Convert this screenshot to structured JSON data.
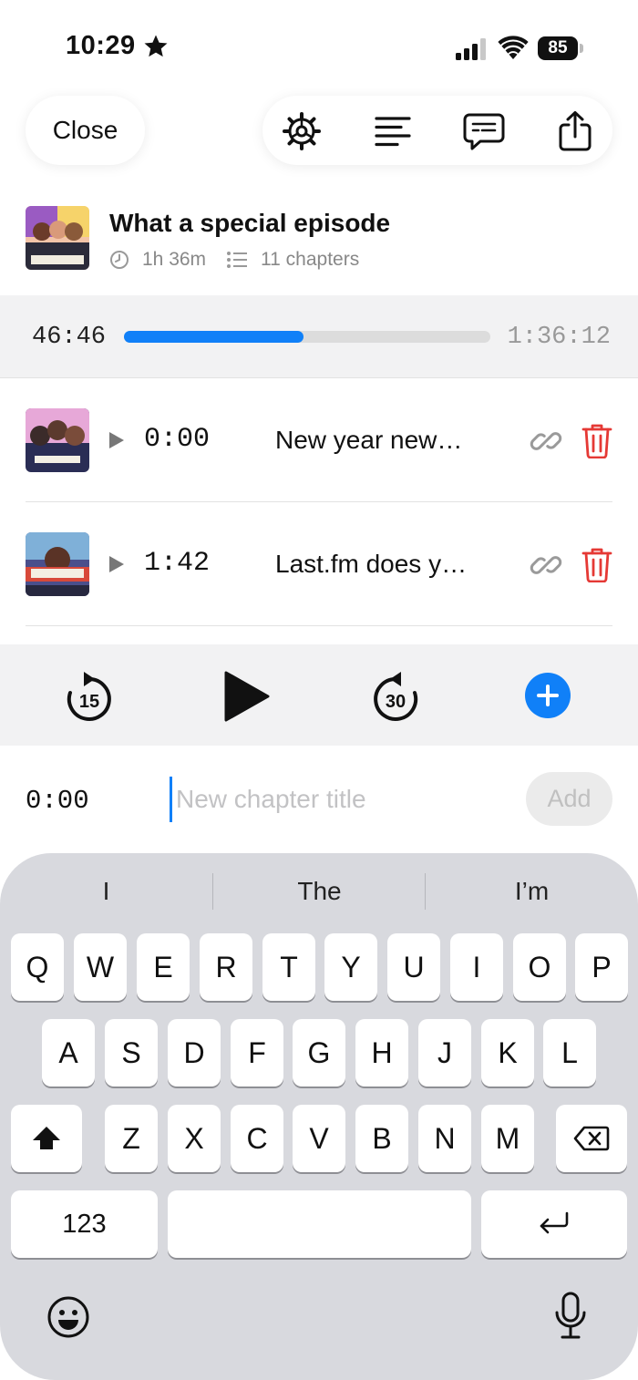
{
  "status_bar": {
    "time": "10:29",
    "battery": "85"
  },
  "toolbar": {
    "close_label": "Close",
    "icons": [
      "gear-icon",
      "lines-icon",
      "transcript-icon",
      "share-icon"
    ]
  },
  "episode": {
    "title": "What a special episode",
    "duration": "1h 36m",
    "chapters_count": "11 chapters"
  },
  "playback": {
    "elapsed": "46:46",
    "remaining": "1:36:12",
    "progress_fraction": 0.49
  },
  "chapters": [
    {
      "time": "0:00",
      "title": "New year new…",
      "art": "cozy-zone-artwork"
    },
    {
      "time": "1:42",
      "title": "Last.fm does y…",
      "art": "comfort-zone-artwork"
    }
  ],
  "transport": {
    "skip_back": "15",
    "skip_forward": "30"
  },
  "add_chapter": {
    "time": "0:00",
    "placeholder": "New chapter title",
    "add_label": "Add"
  },
  "keyboard": {
    "suggestions": [
      "I",
      "The",
      "I’m"
    ],
    "row1": [
      "Q",
      "W",
      "E",
      "R",
      "T",
      "Y",
      "U",
      "I",
      "O",
      "P"
    ],
    "row2": [
      "A",
      "S",
      "D",
      "F",
      "G",
      "H",
      "J",
      "K",
      "L"
    ],
    "row3": [
      "Z",
      "X",
      "C",
      "V",
      "B",
      "N",
      "M"
    ],
    "numbers_label": "123"
  },
  "colors": {
    "accent": "#1080f8",
    "delete": "#e53935",
    "band": "#f2f2f3"
  }
}
